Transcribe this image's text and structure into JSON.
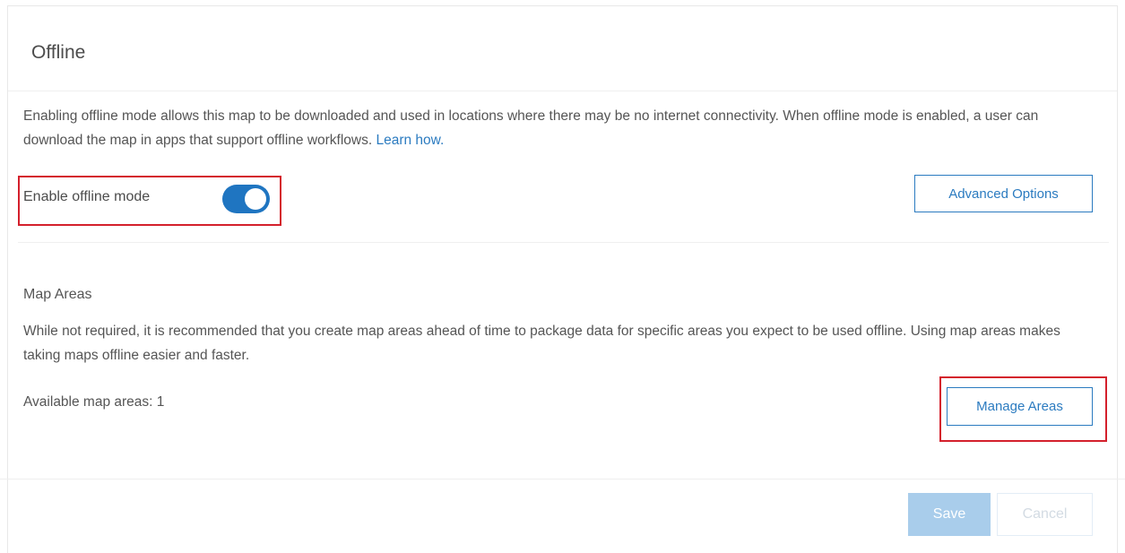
{
  "header": {
    "title": "Offline"
  },
  "intro": {
    "text": "Enabling offline mode allows this map to be downloaded and used in locations where there may be no internet connectivity. When offline mode is enabled, a user can download the map in apps that support offline workflows. ",
    "link": "Learn how."
  },
  "offline_mode": {
    "label": "Enable offline mode",
    "enabled": true,
    "advanced_button": "Advanced Options"
  },
  "map_areas": {
    "title": "Map Areas",
    "description": "While not required, it is recommended that you create map areas ahead of time to package data for specific areas you expect to be used offline. Using map areas makes taking maps offline easier and faster.",
    "available": "Available map areas: 1",
    "manage_button": "Manage Areas"
  },
  "footer": {
    "save_label": "Save",
    "cancel_label": "Cancel"
  },
  "colors": {
    "accent": "#1f75c1",
    "link": "#2b7bc0",
    "highlight": "#d4202c",
    "save_disabled": "#a9cdeb"
  }
}
